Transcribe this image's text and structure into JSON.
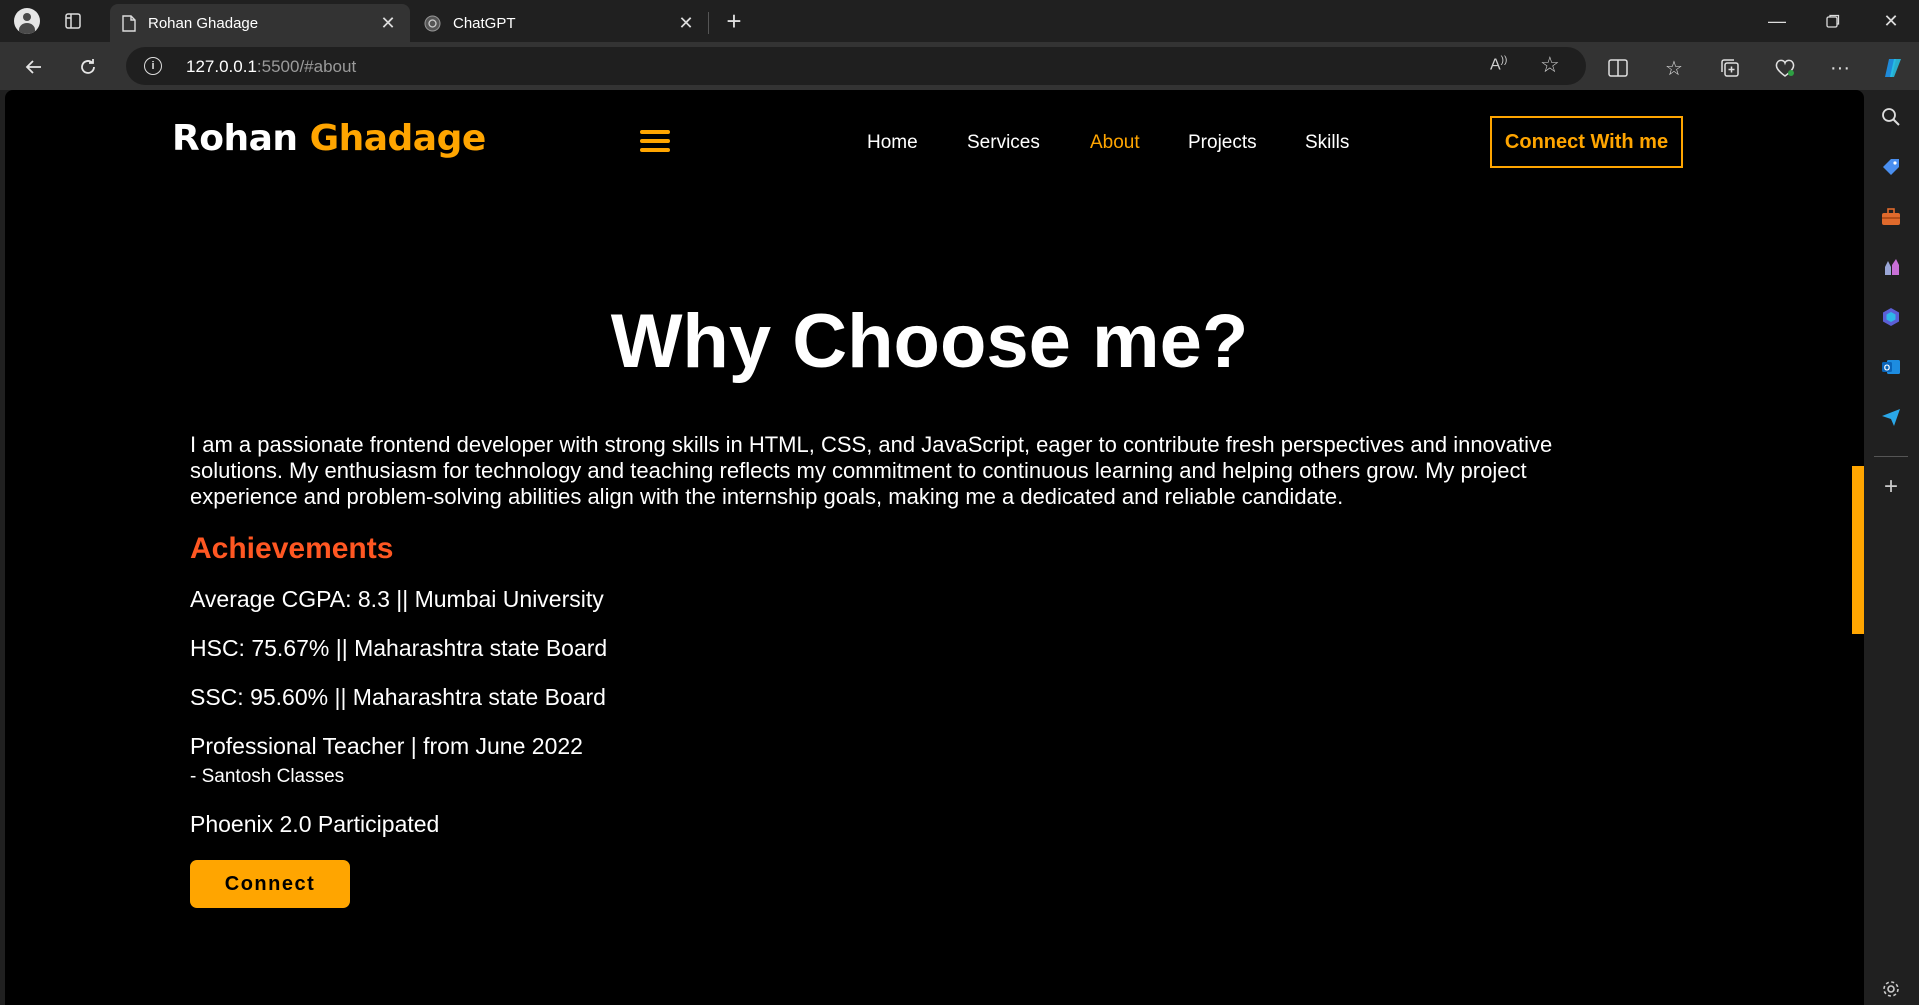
{
  "browser": {
    "tabs": [
      {
        "title": "Rohan Ghadage",
        "active": true
      },
      {
        "title": "ChatGPT",
        "active": false
      }
    ],
    "url_host": "127.0.0.1",
    "url_rest": ":5500/#about"
  },
  "site": {
    "logo_first": "Rohan",
    "logo_second": "Ghadage",
    "nav": {
      "home": "Home",
      "services": "Services",
      "about": "About",
      "projects": "Projects",
      "skills": "Skills"
    },
    "nav_active": "About",
    "connect_nav": "Connect With me"
  },
  "about": {
    "title": "Why Choose me?",
    "intro": "I am a passionate frontend developer with strong skills in HTML, CSS, and JavaScript, eager to contribute fresh perspectives and innovative solutions. My enthusiasm for technology and teaching reflects my commitment to continuous learning and helping others grow. My project experience and problem-solving abilities align with the internship goals, making me a dedicated and reliable candidate.",
    "achievements_title": "Achievements",
    "achievements": [
      "Average CGPA: 8.3 || Mumbai University",
      "HSC: 75.67% || Maharashtra state Board",
      "SSC: 95.60% || Maharashtra state Board",
      "Professional Teacher | from June 2022",
      "Phoenix 2.0 Participated"
    ],
    "teacher_sub": "- Santosh Classes",
    "connect_button": "Connect"
  },
  "colors": {
    "accent": "#ffa500",
    "achievements": "#ff5722",
    "background": "#000000"
  }
}
